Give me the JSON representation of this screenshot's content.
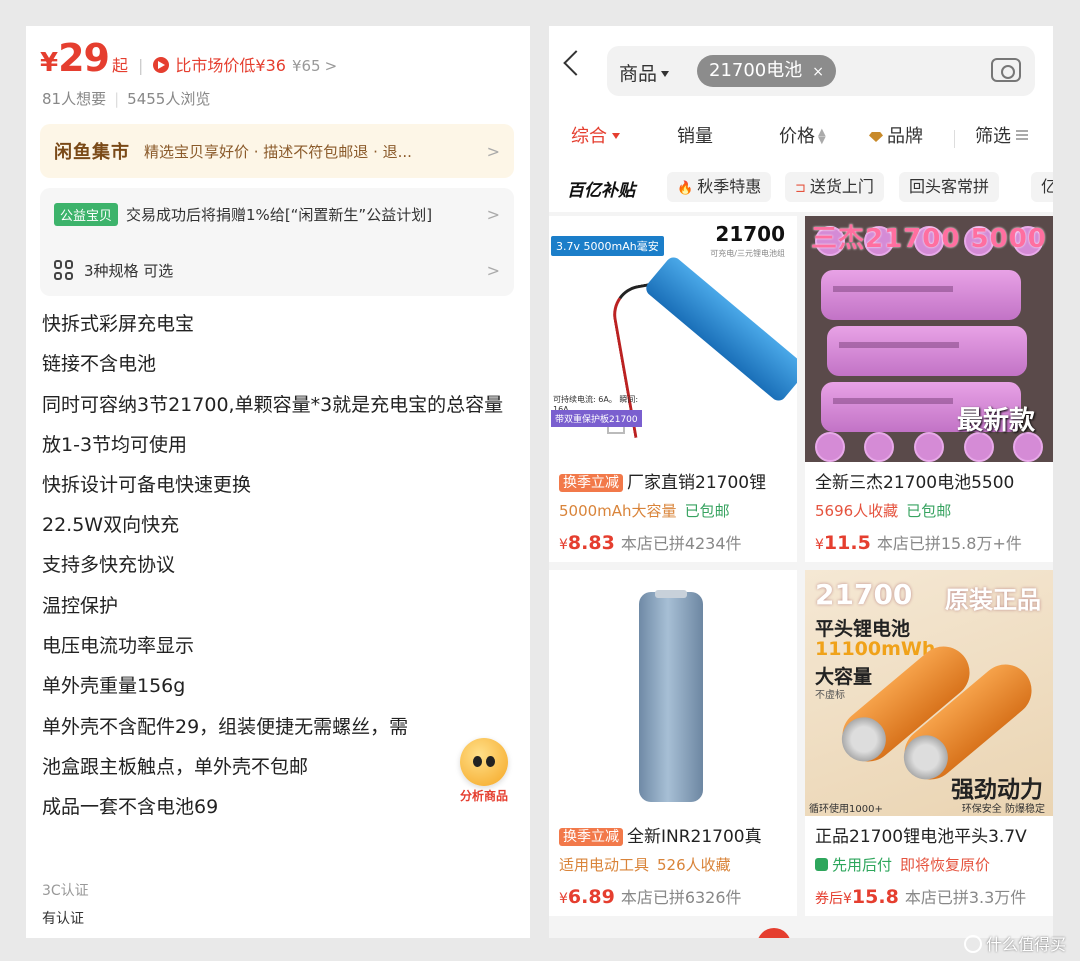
{
  "left": {
    "price": {
      "currency": "¥",
      "value": "29",
      "suffix": "起"
    },
    "compare": {
      "text": "比市场价低¥36",
      "original": "¥65",
      "arrow": ">"
    },
    "stats": {
      "wants": "81人想要",
      "views": "5455人浏览"
    },
    "xianyu_banner": {
      "logo": "闲鱼集市",
      "text": "精选宝贝享好价 · 描述不符包邮退 · 退...",
      "chevron": ">"
    },
    "charity": {
      "badge": "公益宝贝",
      "text": "交易成功后将捐赠1%给[“闲置新生”公益计划]",
      "chevron": ">"
    },
    "specs": {
      "text": "3种规格 可选",
      "chevron": ">"
    },
    "description": [
      "快拆式彩屏充电宝",
      "链接不含电池",
      "同时可容纳3节21700,单颗容量*3就是充电宝的总容量",
      "放1-3节均可使用",
      "快拆设计可备电快速更换",
      "22.5W双向快充",
      "支持多快充协议",
      "温控保护",
      "电压电流功率显示",
      "单外壳重量156g",
      "单外壳不含配件29，组装便捷无需螺丝，需",
      "池盒跟主板触点，单外壳不包邮",
      "成品一套不含电池69"
    ],
    "cert_label": "3C认证",
    "cert_value": "有认证",
    "fab_label": "分析商品"
  },
  "right": {
    "search": {
      "category": "商品",
      "query": "21700电池",
      "clear": "×"
    },
    "sort": {
      "comprehensive": "综合",
      "sales": "销量",
      "price": "价格",
      "brand": "品牌",
      "filter": "筛选"
    },
    "chips": {
      "logo": "百亿补贴",
      "items": [
        "秋季特惠",
        "送货上门",
        "回头客常拼",
        "亿彩"
      ]
    },
    "products": [
      {
        "tag": "换季立减",
        "title": "厂家直销21700锂",
        "sub1": "5000mAh大容量",
        "sub2": "已包邮",
        "price_prefix": "",
        "currency": "¥",
        "price": "8.83",
        "info": "本店已拼4234件",
        "img": {
          "badge": "3.7v 5000mAh毫安",
          "title": "21700",
          "sub": "可充电/三元锂电池组",
          "foot1": "可持续电流: 6A。 瞬间: 16A",
          "foot2": "带双重保护板21700"
        }
      },
      {
        "tag": "",
        "title": "全新三杰21700电池5500",
        "sub1": "5696人收藏",
        "sub2": "已包邮",
        "price_prefix": "",
        "currency": "¥",
        "price": "11.5",
        "info": "本店已拼15.8万+件",
        "img": {
          "headline": "三杰21700 5000",
          "corner": "最新款"
        }
      },
      {
        "tag": "换季立减",
        "title": "全新INR21700真",
        "sub1": "适用电动工具",
        "sub2": "526人收藏",
        "price_prefix": "",
        "currency": "¥",
        "price": "6.89",
        "info": "本店已拼6326件",
        "img": {}
      },
      {
        "tag": "",
        "title": "正品21700锂电池平头3.7V",
        "sub1": "先用后付",
        "sub2": "即将恢复原价",
        "price_prefix": "券后",
        "currency": "¥",
        "price": "15.8",
        "info": "本店已拼3.3万件",
        "img": {
          "h1": "21700",
          "h2": "原装正品",
          "l1": "平头锂电池",
          "l2": "11100mWh",
          "l3": "大容量",
          "l4": "不虚标",
          "power": "强劲动力",
          "f1": "循环使用1000+",
          "f2": "环保安全 防爆稳定"
        }
      }
    ]
  },
  "watermark": "什么值得买",
  "colors": {
    "accent_red": "#e53e2f",
    "green": "#3db36b",
    "orange_tag": "#f2794a"
  }
}
